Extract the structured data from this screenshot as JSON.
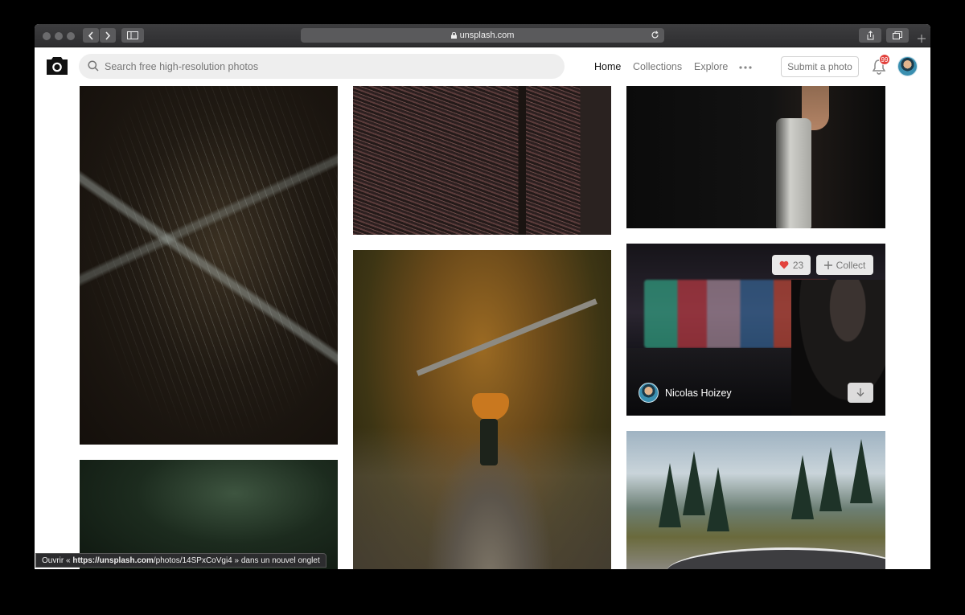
{
  "browser": {
    "url": "unsplash.com"
  },
  "nav": {
    "search_placeholder": "Search free high-resolution photos",
    "links": [
      "Home",
      "Collections",
      "Explore"
    ],
    "submit_label": "Submit a photo",
    "notification_count": "99"
  },
  "feed": {
    "hovered_photo": {
      "like_count": "23",
      "collect_label": "Collect",
      "author": "Nicolas Hoizey"
    }
  },
  "status_bar": {
    "prefix": "Ouvrir «",
    "url_host": "https://unsplash.com",
    "url_path": "/photos/14SPxCoVgi4",
    "suffix": "» dans un nouvel onglet"
  },
  "colors": {
    "like_heart": "#e2413c",
    "badge": "#e2413c"
  }
}
